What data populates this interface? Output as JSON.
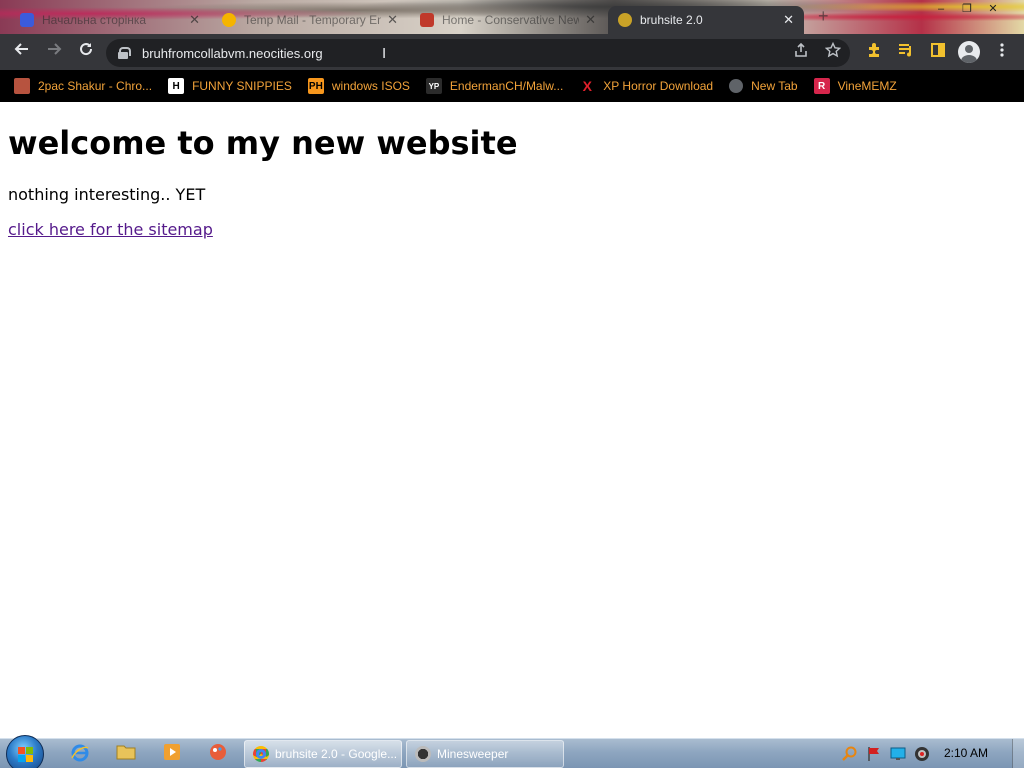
{
  "browser": {
    "tabs": [
      {
        "label": "Начальна сторінка",
        "favicon_color": "#3b5bdb",
        "active": false
      },
      {
        "label": "Temp Mail - Temporary Email",
        "favicon_color": "#f5b400",
        "active": false
      },
      {
        "label": "Home - Conservative News",
        "favicon_color": "#c0392b",
        "active": false
      },
      {
        "label": "bruhsite 2.0",
        "favicon_color": "#c9a227",
        "active": true
      }
    ],
    "close_glyph": "✕",
    "new_tab_glyph": "+",
    "window_controls": [
      "–",
      "❐",
      "✕"
    ],
    "url": "bruhfromcollabvm.neocities.org",
    "bookmarks": [
      {
        "label": "2pac Shakur - Chro...",
        "icon": "profile-image-icon",
        "icon_text": "",
        "icon_bg": "#b7533f"
      },
      {
        "label": "FUNNY SNIPPIES",
        "icon": "h-logo-icon",
        "icon_text": "H",
        "icon_bg": "#ffffff"
      },
      {
        "label": "windows ISOS",
        "icon": "ph-logo-icon",
        "icon_text": "PH",
        "icon_bg": "#f7971d"
      },
      {
        "label": "EndermanCH/Malw...",
        "icon": "yp-logo-icon",
        "icon_text": "YP",
        "icon_bg": "#2b2b2b"
      },
      {
        "label": "XP Horror Download",
        "icon": "x-logo-icon",
        "icon_text": "X",
        "icon_bg": "#000000"
      },
      {
        "label": "New Tab",
        "icon": "globe-icon",
        "icon_text": "",
        "icon_bg": "#5f6368"
      },
      {
        "label": "VineMEMZ",
        "icon": "r-logo-icon",
        "icon_text": "R",
        "icon_bg": "#d6264c"
      }
    ],
    "colors": {
      "toolbar": "#35363a",
      "bookmark_text": "#f2a33a"
    }
  },
  "page": {
    "heading": "welcome to my new website",
    "paragraph": "nothing interesting.. YET",
    "link_text": "click here for the sitemap"
  },
  "taskbar": {
    "tasks": [
      {
        "label": "bruhsite 2.0 - Google...",
        "icon": "chrome-icon",
        "active": true
      },
      {
        "label": "Minesweeper",
        "icon": "minesweeper-icon",
        "active": false
      }
    ],
    "clock": "2:10 AM"
  }
}
